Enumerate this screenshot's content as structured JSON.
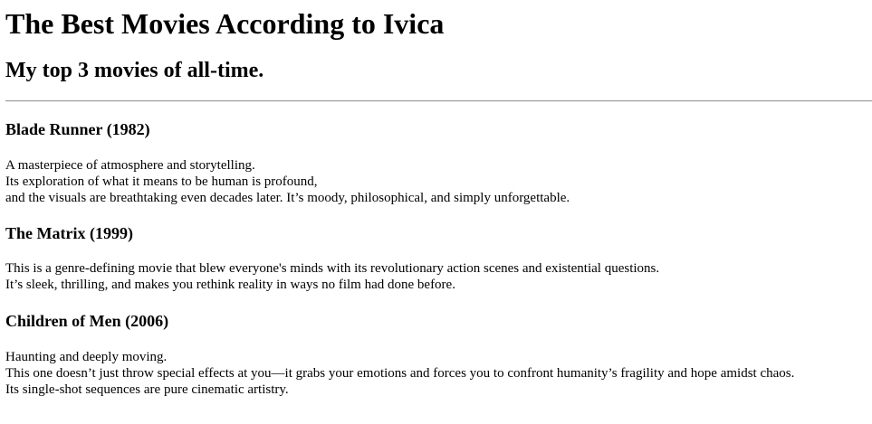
{
  "page": {
    "title": "The Best Movies According to Ivica",
    "subtitle": "My top 3 movies of all-time."
  },
  "movies": [
    {
      "heading": "Blade Runner (1982)",
      "lines": [
        "A masterpiece of atmosphere and storytelling.",
        "Its exploration of what it means to be human is profound,",
        "and the visuals are breathtaking even decades later. It’s moody, philosophical, and simply unforgettable."
      ]
    },
    {
      "heading": "The Matrix (1999)",
      "lines": [
        "This is a genre-defining movie that blew everyone's minds with its revolutionary action scenes and existential questions.",
        "It’s sleek, thrilling, and makes you rethink reality in ways no film had done before."
      ]
    },
    {
      "heading": "Children of Men (2006)",
      "lines": [
        "Haunting and deeply moving.",
        "This one doesn’t just throw special effects at you—it grabs your emotions and forces you to confront humanity’s fragility and hope amidst chaos.",
        "Its single-shot sequences are pure cinematic artistry."
      ]
    }
  ]
}
